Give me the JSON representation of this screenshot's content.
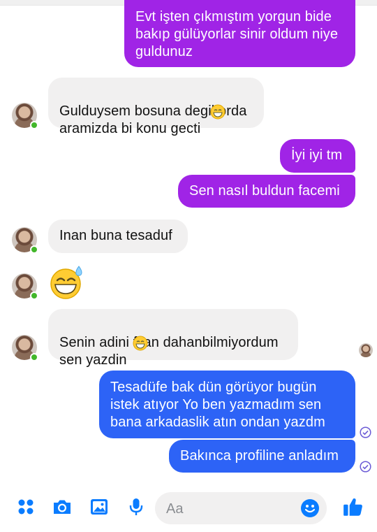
{
  "messages": [
    {
      "text": "Evt işten çıkmıştım yorgun bide\nbakıp gülüyorlar sinir oldum niye\nguldunuz"
    },
    {
      "text": "Gulduysem bosuna degil orda\naramizda bi konu gecti"
    },
    {
      "text": "İyi iyi tm"
    },
    {
      "text": "Sen nasıl buldun facemi"
    },
    {
      "text": "Inan buna tesaduf"
    },
    {
      "text": "Senin adini filan dahanbilmiyordum\nsen yazdin"
    },
    {
      "text": "Tesadüfe bak dün görüyor bugün\nistek atıyor Yo ben yazmadım sen\nbana arkadaslik atın ondan yazdm"
    },
    {
      "text": "Bakınca profiline anladım"
    }
  ],
  "composer": {
    "placeholder": "Aa",
    "tools": [
      "menu-icon",
      "camera-icon",
      "gallery-icon",
      "microphone-icon"
    ],
    "emoji_icon": "smile-icon",
    "send_icon": "thumbs-up-icon"
  },
  "colors": {
    "purple": "#a024e6",
    "blue": "#2d63f6",
    "incoming": "#f1f0f0",
    "messenger_blue": "#0a7cff",
    "online": "#42b72a"
  }
}
